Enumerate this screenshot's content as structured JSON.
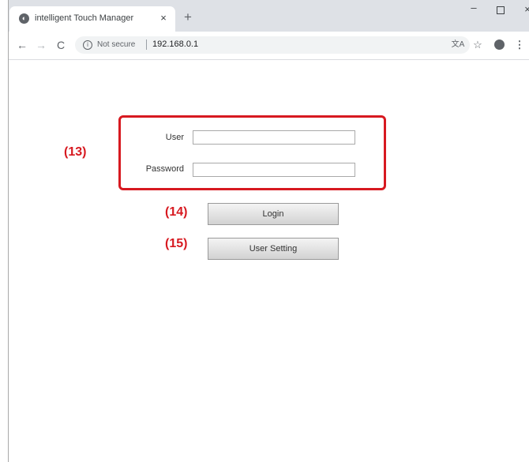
{
  "browser": {
    "tab_title": "intelligent Touch Manager",
    "tab_close": "×",
    "new_tab": "+",
    "min": "–",
    "close": "×",
    "back": "←",
    "forward": "→",
    "reload": "C",
    "security_icon": "i",
    "security_text": "Not secure",
    "url": "192.168.0.1",
    "menu": "⋮"
  },
  "icons": {
    "favicon": "globe-icon",
    "translate": "translate-icon",
    "bookmark": "star-icon",
    "account": "account-icon"
  },
  "login": {
    "user_label": "User",
    "user_value": "",
    "password_label": "Password",
    "password_value": "",
    "login_button": "Login",
    "user_setting_button": "User Setting"
  },
  "callouts": {
    "fields": "(13)",
    "login": "(14)",
    "user_setting": "(15)"
  },
  "colors": {
    "callout": "#d71920",
    "tabbar": "#dee1e6",
    "omnibox": "#f1f3f4"
  }
}
